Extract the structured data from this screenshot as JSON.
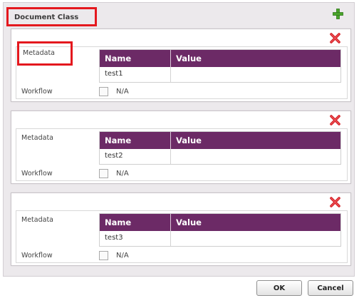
{
  "dialog": {
    "title": "Document Class",
    "add_icon": "plus-icon",
    "delete_icon": "x-icon"
  },
  "classes": [
    {
      "metadata_label": "Metadata",
      "table": {
        "header": [
          "Name",
          "Value"
        ],
        "rows": [
          [
            "test1",
            ""
          ]
        ]
      },
      "workflow_label": "Workflow",
      "workflow_value": "N/A"
    },
    {
      "metadata_label": "Metadata",
      "table": {
        "header": [
          "Name",
          "Value"
        ],
        "rows": [
          [
            "test2",
            ""
          ]
        ]
      },
      "workflow_label": "Workflow",
      "workflow_value": "N/A"
    },
    {
      "metadata_label": "Metadata",
      "table": {
        "header": [
          "Name",
          "Value"
        ],
        "rows": [
          [
            "test3",
            ""
          ]
        ]
      },
      "workflow_label": "Workflow",
      "workflow_value": "N/A"
    }
  ],
  "buttons": {
    "ok": "OK",
    "cancel": "Cancel"
  },
  "colors": {
    "header_bg": "#6c2a66",
    "highlight_border": "#e4181e",
    "add_icon": "#4aa32b",
    "delete_icon": "#d42026"
  }
}
